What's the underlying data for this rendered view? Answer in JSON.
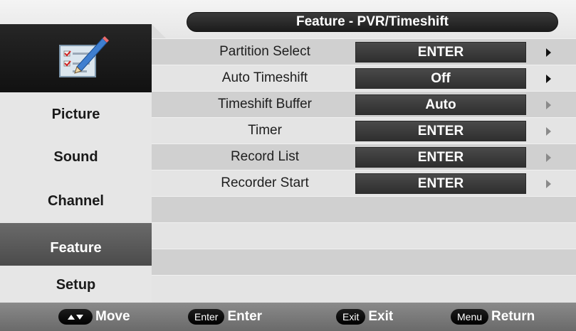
{
  "menu": {
    "title": "Feature - PVR/Timeshift"
  },
  "sidebar": {
    "icon": "checklist-pencil-icon",
    "items": [
      {
        "label": "Picture",
        "active": false
      },
      {
        "label": "Sound",
        "active": false
      },
      {
        "label": "Channel",
        "active": false
      },
      {
        "label": "Feature",
        "active": true
      },
      {
        "label": "Setup",
        "active": false
      }
    ]
  },
  "options": [
    {
      "label": "Partition Select",
      "value": "ENTER",
      "arrow": "enabled"
    },
    {
      "label": "Auto Timeshift",
      "value": "Off",
      "arrow": "enabled"
    },
    {
      "label": "Timeshift Buffer",
      "value": "Auto",
      "arrow": "disabled"
    },
    {
      "label": "Timer",
      "value": "ENTER",
      "arrow": "disabled"
    },
    {
      "label": "Record List",
      "value": "ENTER",
      "arrow": "disabled"
    },
    {
      "label": "Recorder Start",
      "value": "ENTER",
      "arrow": "disabled"
    }
  ],
  "hints": [
    {
      "key_icon": "up-down-arrows-icon",
      "key": "",
      "label": "Move"
    },
    {
      "key_icon": "",
      "key": "Enter",
      "label": "Enter"
    },
    {
      "key_icon": "",
      "key": "Exit",
      "label": "Exit"
    },
    {
      "key_icon": "",
      "key": "Menu",
      "label": "Return"
    }
  ],
  "colors": {
    "title_bar": "#262626",
    "value_box": "#3c3c3c",
    "active_tab": "#5a5a5a",
    "bottom_bar": "#7a7a7a"
  }
}
